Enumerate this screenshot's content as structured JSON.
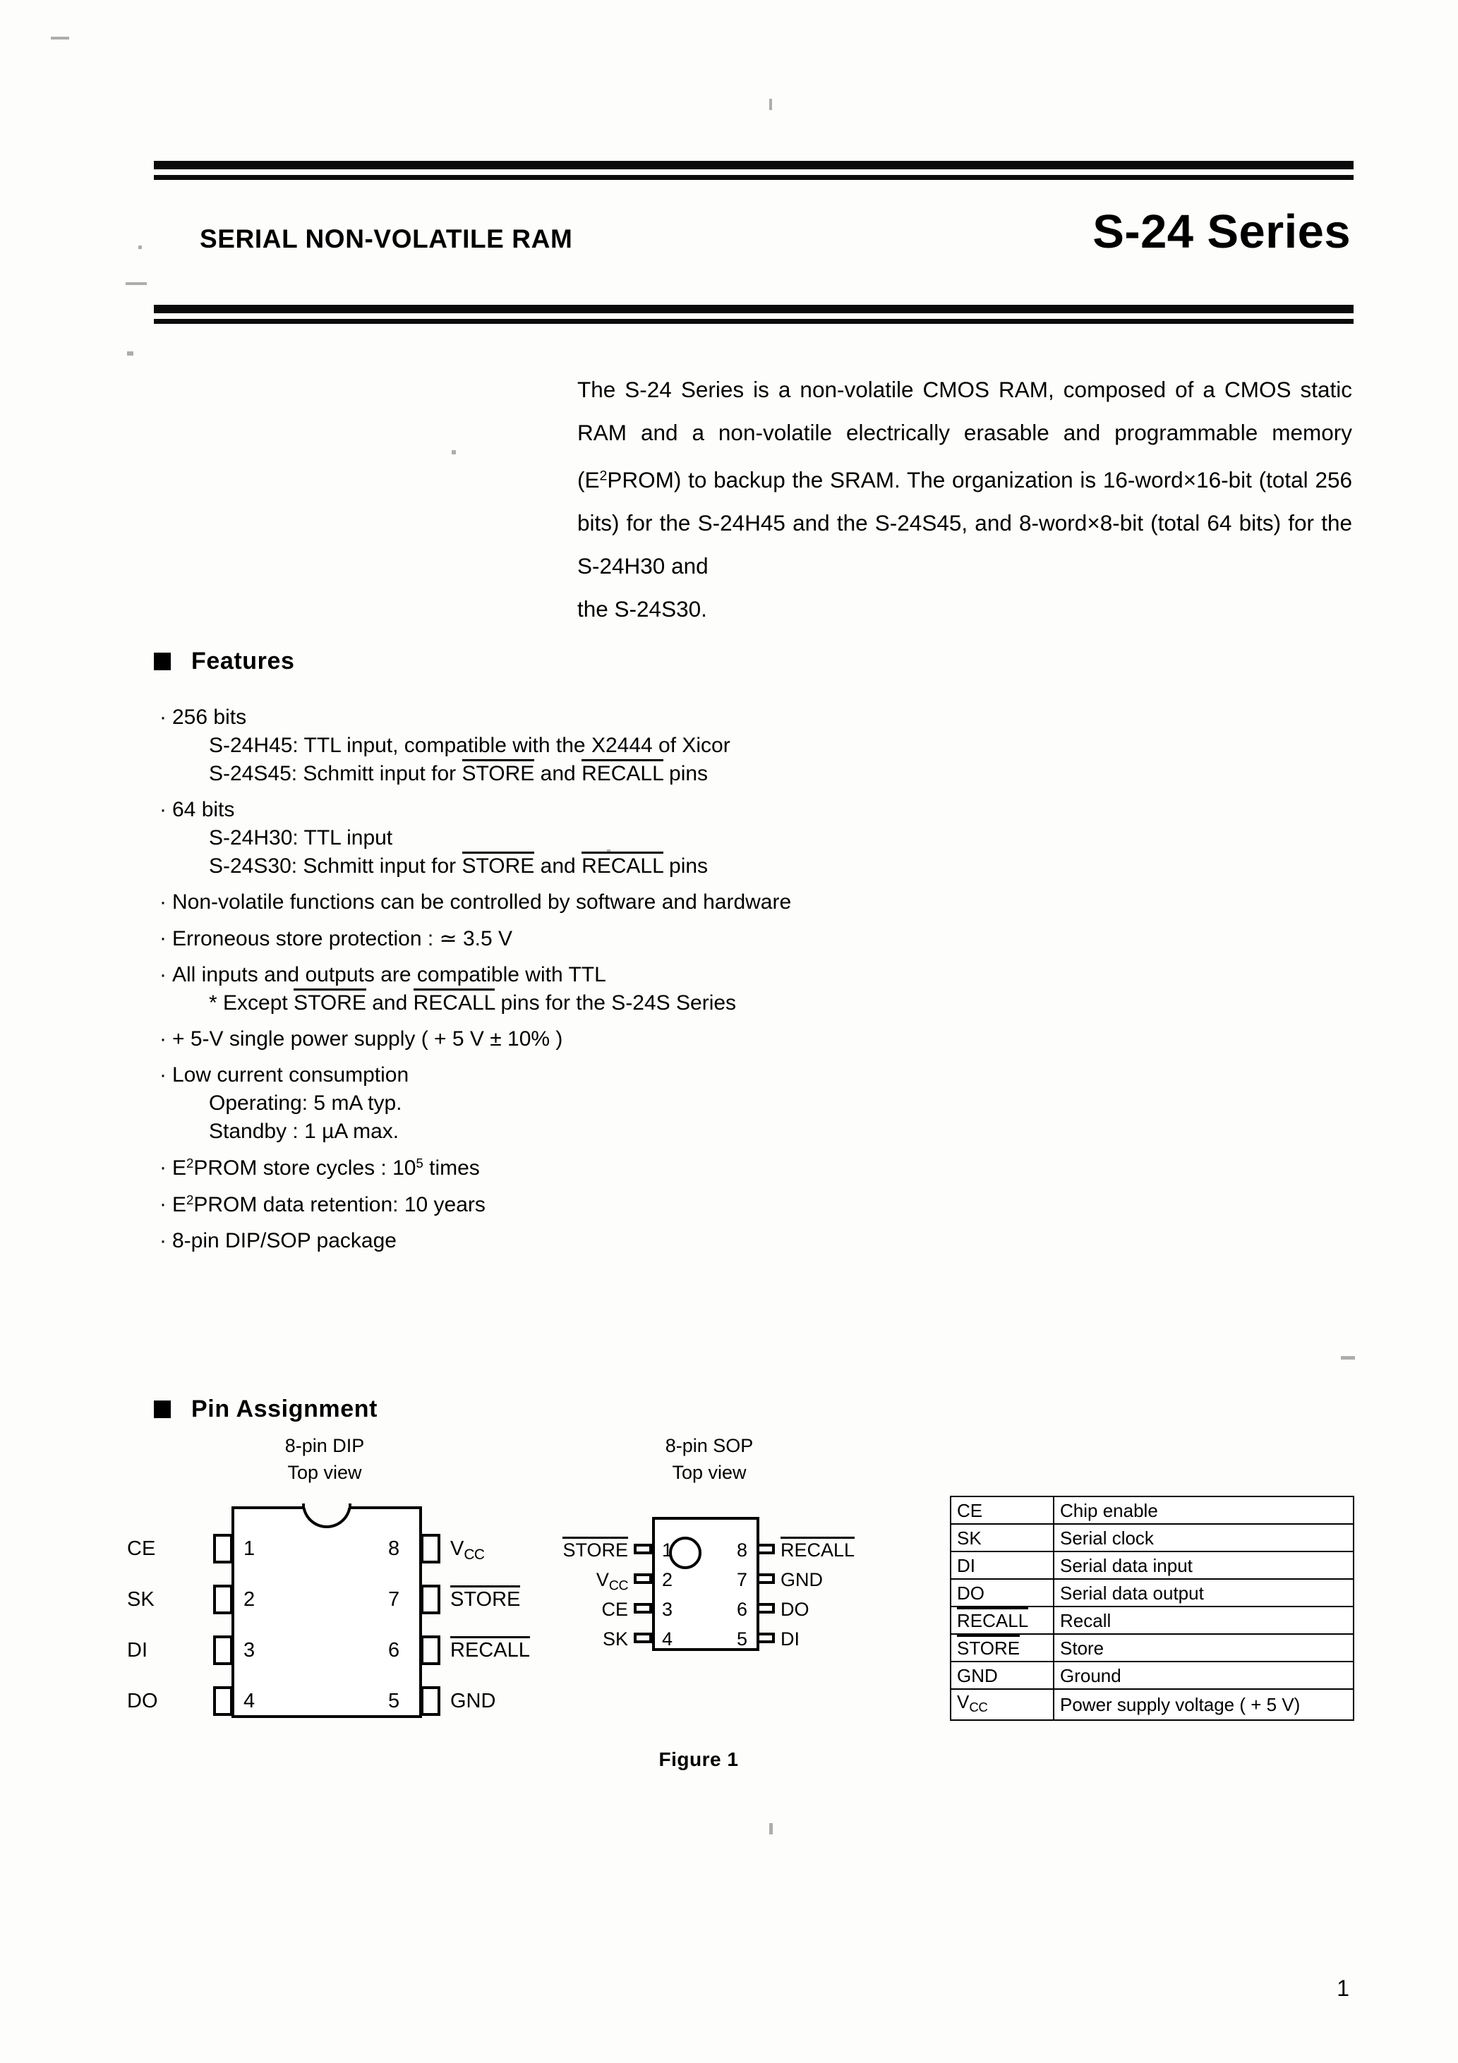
{
  "header": {
    "left_title": "SERIAL NON-VOLATILE RAM",
    "right_title": "S-24 Series"
  },
  "intro": {
    "text": "The S-24 Series is a non-volatile CMOS RAM, composed of a CMOS static RAM and a non-volatile electrically erasable and programmable memory (E2PROM) to backup the SRAM.  The organization is 16-word×16-bit (total 256 bits) for the S-24H45 and the S-24S45, and 8-word×8-bit (total 64 bits) for the S-24H30 and",
    "last_line": "the S-24S30."
  },
  "features": {
    "heading": "Features",
    "items": [
      {
        "bullet": "256 bits",
        "subs": [
          "S-24H45: TTL input, compatible with the X2444 of Xicor",
          "S-24S45: Schmitt input for STORE and RECALL pins"
        ]
      },
      {
        "bullet": "64 bits",
        "subs": [
          "S-24H30: TTL input",
          "S-24S30: Schmitt input for STORE and RECALL pins"
        ]
      },
      {
        "bullet": "Non-volatile functions can be controlled by software and hardware",
        "subs": []
      },
      {
        "bullet": "Erroneous store protection : ≃ 3.5 V",
        "subs": []
      },
      {
        "bullet": "All inputs and outputs are compatible with TTL",
        "subs": [
          "* Except STORE and RECALL pins for the S-24S Series"
        ]
      },
      {
        "bullet": "+ 5-V single power supply ( + 5 V ± 10% )",
        "subs": []
      },
      {
        "bullet": "Low current consumption",
        "subs": [
          "Operating:  5 mA typ.",
          "Standby  :  1 µA  max."
        ]
      },
      {
        "bullet": "E2PROM store cycles : 105 times",
        "subs": []
      },
      {
        "bullet": "E2PROM data retention: 10 years",
        "subs": []
      },
      {
        "bullet": "8-pin DIP/SOP package",
        "subs": []
      }
    ]
  },
  "pin_assignment": {
    "heading": "Pin Assignment",
    "dip": {
      "title_line1": "8-pin DIP",
      "title_line2": "Top view",
      "left_pins": [
        {
          "num": "1",
          "label": "CE"
        },
        {
          "num": "2",
          "label": "SK"
        },
        {
          "num": "3",
          "label": "DI"
        },
        {
          "num": "4",
          "label": "DO"
        }
      ],
      "right_pins": [
        {
          "num": "8",
          "label": "Vcc",
          "overline": false
        },
        {
          "num": "7",
          "label": "STORE",
          "overline": true
        },
        {
          "num": "6",
          "label": "RECALL",
          "overline": true
        },
        {
          "num": "5",
          "label": "GND",
          "overline": false
        }
      ]
    },
    "sop": {
      "title_line1": "8-pin SOP",
      "title_line2": "Top view",
      "left_pins": [
        {
          "num": "1",
          "label": "STORE",
          "overline": true
        },
        {
          "num": "2",
          "label": "Vcc",
          "overline": false
        },
        {
          "num": "3",
          "label": "CE",
          "overline": false
        },
        {
          "num": "4",
          "label": "SK",
          "overline": false
        }
      ],
      "right_pins": [
        {
          "num": "8",
          "label": "RECALL",
          "overline": true
        },
        {
          "num": "7",
          "label": "GND",
          "overline": false
        },
        {
          "num": "6",
          "label": "DO",
          "overline": false
        },
        {
          "num": "5",
          "label": "DI",
          "overline": false
        }
      ]
    },
    "table": [
      {
        "symbol": "CE",
        "overline": false,
        "description": "Chip enable"
      },
      {
        "symbol": "SK",
        "overline": false,
        "description": "Serial clock"
      },
      {
        "symbol": "DI",
        "overline": false,
        "description": "Serial data input"
      },
      {
        "symbol": "DO",
        "overline": false,
        "description": "Serial data output"
      },
      {
        "symbol": "RECALL",
        "overline": true,
        "description": "Recall"
      },
      {
        "symbol": "STORE",
        "overline": true,
        "description": "Store"
      },
      {
        "symbol": "GND",
        "overline": false,
        "description": "Ground"
      },
      {
        "symbol": "Vcc",
        "overline": false,
        "description": "Power supply voltage ( + 5 V)"
      }
    ],
    "figure_caption": "Figure 1"
  },
  "page_number": "1"
}
